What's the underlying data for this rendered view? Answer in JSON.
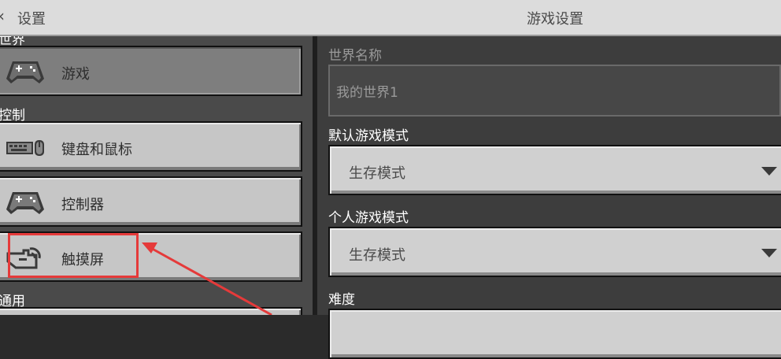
{
  "header": {
    "back_label": "设置",
    "title": "游戏设置"
  },
  "sidebar": {
    "sections": [
      {
        "label": "世界"
      },
      {
        "label": "控制"
      },
      {
        "label": "通用"
      }
    ],
    "items": [
      {
        "label": "游戏",
        "icon": "gamepad-icon",
        "active": true
      },
      {
        "label": "键盘和鼠标",
        "icon": "keyboard-mouse-icon",
        "active": false
      },
      {
        "label": "控制器",
        "icon": "gamepad-icon",
        "active": false
      },
      {
        "label": "触摸屏",
        "icon": "touch-hand-icon",
        "active": false
      }
    ]
  },
  "main": {
    "world_name_label": "世界名称",
    "world_name_value": "我的世界1",
    "default_mode_label": "默认游戏模式",
    "default_mode_value": "生存模式",
    "personal_mode_label": "个人游戏模式",
    "personal_mode_value": "生存模式",
    "difficulty_label": "难度"
  },
  "colors": {
    "highlight": "#e53a3a",
    "button_face": "#c6c6c6",
    "panel": "#3d3d3d"
  }
}
